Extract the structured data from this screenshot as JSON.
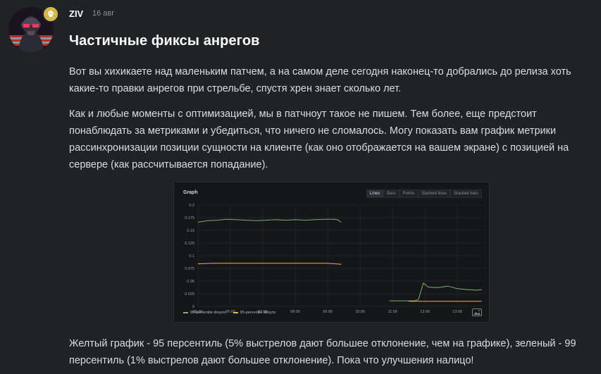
{
  "post": {
    "author": "ZIV",
    "date": "16 авг",
    "title": "Частичные фиксы анрегов",
    "paragraphs": [
      "Вот вы хихикаете над маленьким патчем, а на самом деле сегодня наконец-то добрались до релиза хоть какие-то правки анрегов при стрельбе, спустя хрен знает сколько лет.",
      "Как и любые моменты с оптимизацией, мы в патчноут такое не пишем. Тем более, еще предстоит понаблюдать за метриками и убедиться, что ничего не сломалось. Могу показать вам график метрики рассинхронизации позиции сущности на клиенте (как оно отображается на вашем экране) с позицией на сервере (как рассчитывается попадание).",
      "Желтый график - 95 персентиль (5% выстрелов дают большее отклонение, чем на графике), зеленый - 99 персентиль (1% выстрелов дают большее отклонение). Пока что улучшения налицо!"
    ]
  },
  "graph": {
    "title": "Graph",
    "tabs": [
      "Lines",
      "Bars",
      "Points",
      "Stacked lines",
      "Stacked bars"
    ],
    "active_tab": "Lines"
  },
  "colors": {
    "green": "#7eb26d",
    "yellow": "#eab839",
    "badge": "#d8b84a"
  },
  "chart_data": {
    "type": "line",
    "title": "Graph",
    "xlabel": "",
    "ylabel": "",
    "x_ticks": [
      "05:00",
      "06:00",
      "07:00",
      "08:00",
      "09:00",
      "10:00",
      "11:00",
      "12:00",
      "13:00"
    ],
    "y_ticks": [
      "0",
      "0.025",
      "0.05",
      "0.075",
      "0.1",
      "0.125",
      "0.15",
      "0.175",
      "0.2"
    ],
    "ylim": [
      0,
      0.2
    ],
    "xlim": [
      5.0,
      13.8
    ],
    "grid": true,
    "legend": "bottom-left",
    "series": [
      {
        "name": "99-percentile desync",
        "color": "#7eb26d",
        "segments": [
          [
            [
              5.0,
              0.166
            ],
            [
              5.3,
              0.169
            ],
            [
              5.6,
              0.17
            ],
            [
              5.9,
              0.172
            ],
            [
              6.2,
              0.171
            ],
            [
              6.5,
              0.17
            ],
            [
              6.8,
              0.169
            ],
            [
              7.1,
              0.17
            ],
            [
              7.4,
              0.171
            ],
            [
              7.7,
              0.17
            ],
            [
              8.0,
              0.171
            ],
            [
              8.3,
              0.17
            ],
            [
              8.6,
              0.171
            ],
            [
              8.9,
              0.172
            ],
            [
              9.2,
              0.172
            ],
            [
              9.3,
              0.171
            ],
            [
              9.42,
              0.166
            ]
          ],
          [
            [
              10.9,
              0.011
            ],
            [
              11.7,
              0.011
            ],
            [
              11.8,
              0.014
            ],
            [
              11.95,
              0.046
            ],
            [
              12.1,
              0.038
            ],
            [
              12.4,
              0.037
            ],
            [
              12.7,
              0.04
            ],
            [
              13.0,
              0.035
            ],
            [
              13.3,
              0.033
            ],
            [
              13.6,
              0.032
            ],
            [
              13.75,
              0.033
            ]
          ]
        ]
      },
      {
        "name": "95-percentile desync",
        "color": "#eab839",
        "segments": [
          [
            [
              5.0,
              0.084
            ],
            [
              5.5,
              0.085
            ],
            [
              6.0,
              0.085
            ],
            [
              6.5,
              0.085
            ],
            [
              7.0,
              0.085
            ],
            [
              7.5,
              0.085
            ],
            [
              8.0,
              0.085
            ],
            [
              8.5,
              0.085
            ],
            [
              9.0,
              0.085
            ],
            [
              9.42,
              0.083
            ]
          ],
          [
            [
              11.5,
              0.01
            ],
            [
              11.9,
              0.01
            ],
            [
              12.4,
              0.01
            ],
            [
              12.9,
              0.01
            ],
            [
              13.4,
              0.01
            ],
            [
              13.75,
              0.01
            ]
          ]
        ]
      }
    ]
  }
}
